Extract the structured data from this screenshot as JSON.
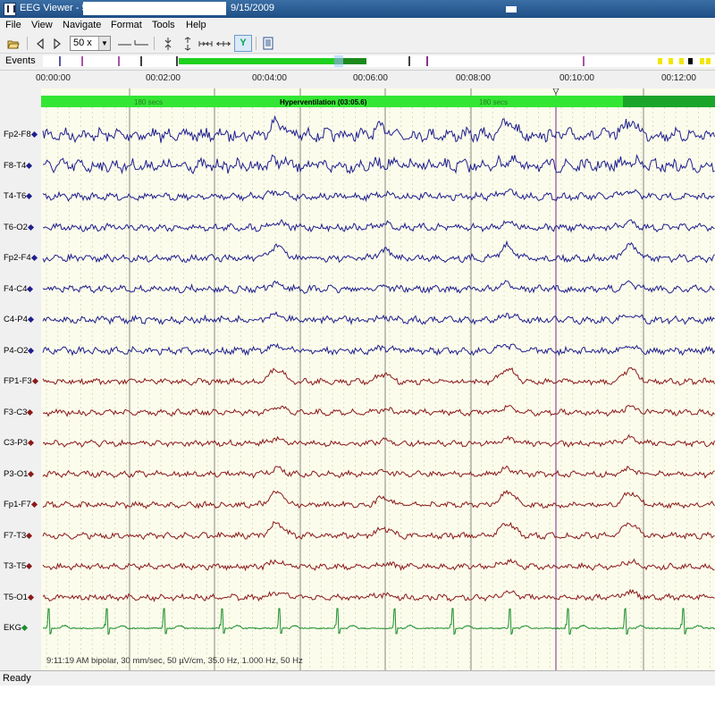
{
  "window": {
    "title": "EEG Viewer - 5",
    "date": "9/15/2009"
  },
  "menu": [
    "File",
    "View",
    "Navigate",
    "Format",
    "Tools",
    "Help"
  ],
  "toolbar": {
    "zoom_value": "50 x"
  },
  "events_label": "Events",
  "ruler": [
    "00:00:00",
    "00:02:00",
    "00:04:00",
    "00:06:00",
    "00:08:00",
    "00:10:00",
    "00:12:00"
  ],
  "annotations": {
    "segment_1": "180 secs",
    "main": "Hyperventilation (03:05.6)",
    "segment_2": "180 secs"
  },
  "channels": [
    {
      "name": "Fp2-F8",
      "group": "right"
    },
    {
      "name": "F8-T4",
      "group": "right"
    },
    {
      "name": "T4-T6",
      "group": "right"
    },
    {
      "name": "T6-O2",
      "group": "right"
    },
    {
      "name": "Fp2-F4",
      "group": "right"
    },
    {
      "name": "F4-C4",
      "group": "right"
    },
    {
      "name": "C4-P4",
      "group": "right"
    },
    {
      "name": "P4-O2",
      "group": "right"
    },
    {
      "name": "FP1-F3",
      "group": "left"
    },
    {
      "name": "F3-C3",
      "group": "left"
    },
    {
      "name": "C3-P3",
      "group": "left"
    },
    {
      "name": "P3-O1",
      "group": "left"
    },
    {
      "name": "Fp1-F7",
      "group": "left"
    },
    {
      "name": "F7-T3",
      "group": "left"
    },
    {
      "name": "T3-T5",
      "group": "left"
    },
    {
      "name": "T5-O1",
      "group": "left"
    },
    {
      "name": "EKG",
      "group": "ekg"
    }
  ],
  "colors": {
    "right": "#1f1f8f",
    "left": "#8b1a1a",
    "ekg": "#1a8f2a",
    "annotation": "#33e633",
    "annotation_dark": "#1aa52a",
    "event_purple": "#8a1a8a",
    "event_yellow": "#f2e600",
    "plot_bg": "#fcfcec"
  },
  "footer": "9:11:19 AM bipolar, 30 mm/sec, 50 µV/cm, 35.0 Hz, 1.000 Hz, 50 Hz",
  "status": "Ready"
}
